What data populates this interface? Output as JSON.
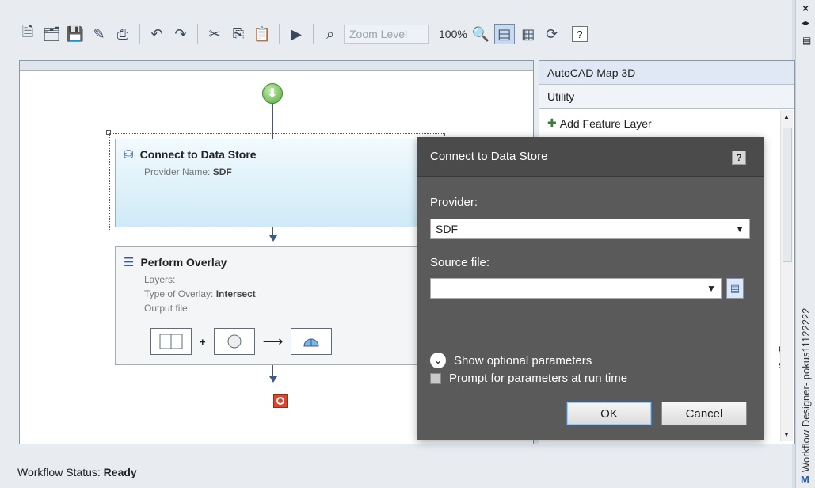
{
  "toolbar": {
    "zoom_placeholder": "Zoom Level",
    "zoom_percent": "100%",
    "help_label": "?"
  },
  "canvas": {
    "connect": {
      "title": "Connect to Data Store",
      "provider_label": "Provider Name:",
      "provider_value": "SDF"
    },
    "overlay": {
      "title": "Perform Overlay",
      "layers_label": "Layers:",
      "type_label": "Type of Overlay:",
      "type_value": "Intersect",
      "output_label": "Output file:"
    }
  },
  "panel": {
    "header1": "AutoCAD Map 3D",
    "header2": "Utility",
    "item1": "Add Feature Layer",
    "partial_text1": "gh",
    "partial_text2": "s"
  },
  "side": {
    "close": "×",
    "vertical_title": "Workflow Designer- pokus11122222",
    "bottom_text": "M"
  },
  "status": {
    "label": "Workflow Status:",
    "value": "Ready"
  },
  "dialog": {
    "title": "Connect to Data Store",
    "help": "?",
    "provider_label": "Provider:",
    "provider_value": "SDF",
    "source_label": "Source file:",
    "source_value": "",
    "optional_label": "Show optional parameters",
    "prompt_label": "Prompt for parameters at run time",
    "ok_label": "OK",
    "cancel_label": "Cancel"
  }
}
